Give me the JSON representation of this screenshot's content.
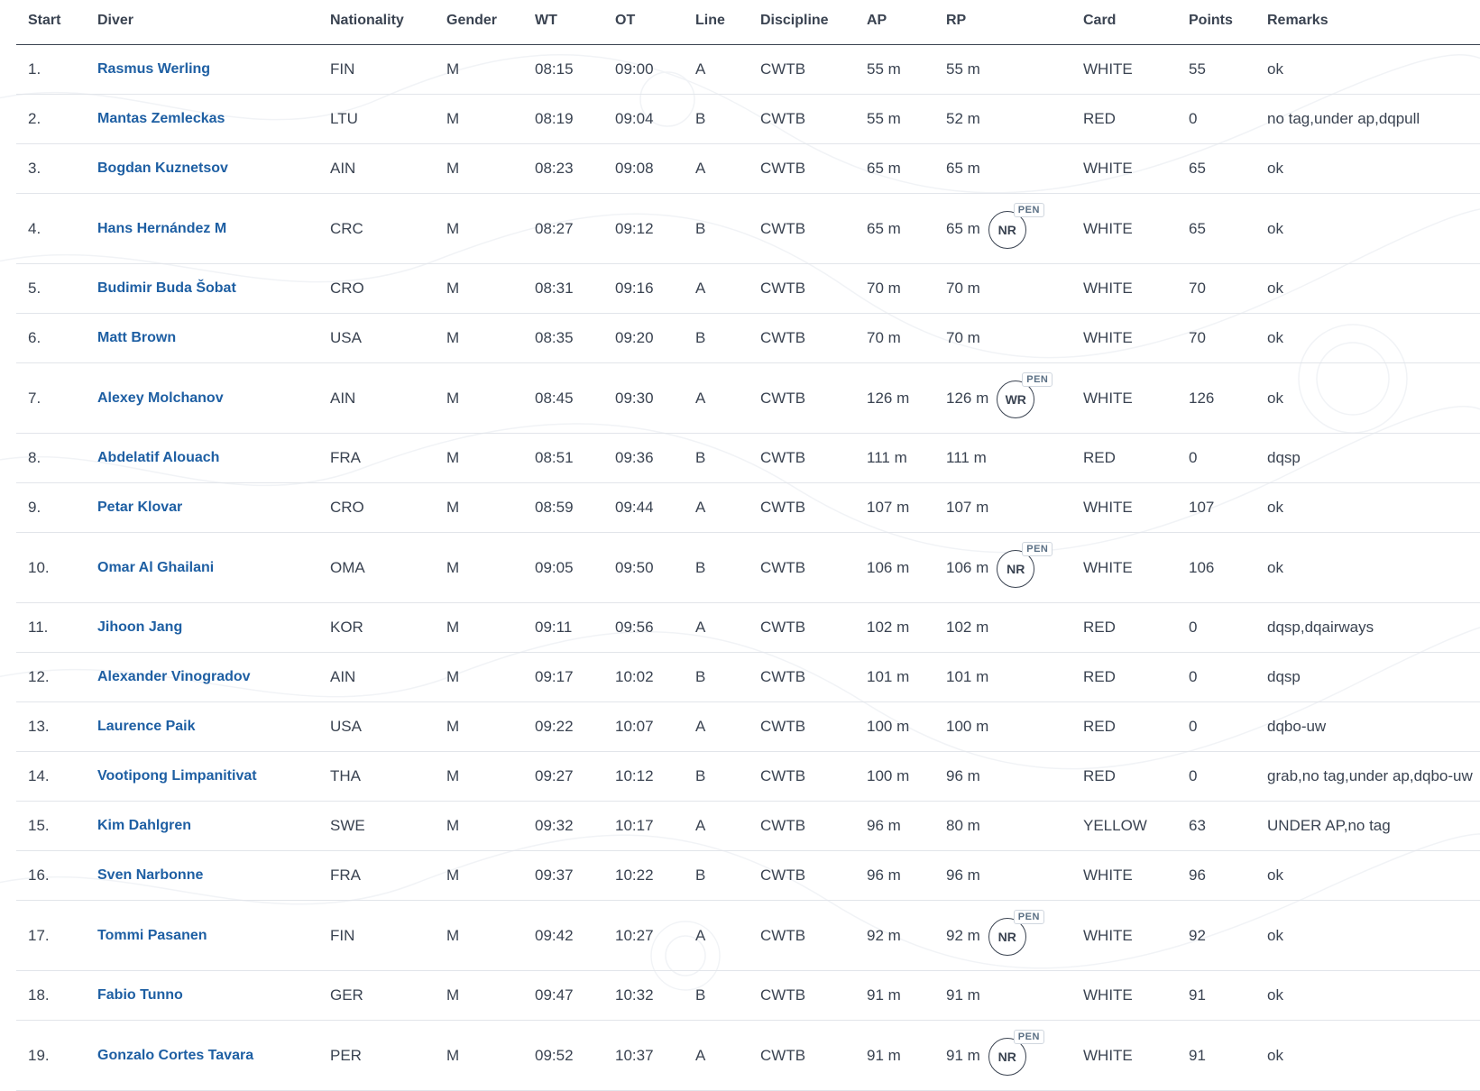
{
  "headers": {
    "start": "Start",
    "diver": "Diver",
    "nationality": "Nationality",
    "gender": "Gender",
    "wt": "WT",
    "ot": "OT",
    "line": "Line",
    "discipline": "Discipline",
    "ap": "AP",
    "rp": "RP",
    "card": "Card",
    "points": "Points",
    "remarks": "Remarks"
  },
  "colors": {
    "link": "#1e5fa3",
    "text": "#3a4351",
    "divider": "#e2e5ea"
  },
  "rows": [
    {
      "start": "1.",
      "diver": "Rasmus Werling",
      "nat": "FIN",
      "gender": "M",
      "wt": "08:15",
      "ot": "09:00",
      "line": "A",
      "disc": "CWTB",
      "ap": "55 m",
      "rp": "55 m",
      "badge": "",
      "pen": "",
      "card": "WHITE",
      "points": "55",
      "remarks": "ok"
    },
    {
      "start": "2.",
      "diver": "Mantas Zemleckas",
      "nat": "LTU",
      "gender": "M",
      "wt": "08:19",
      "ot": "09:04",
      "line": "B",
      "disc": "CWTB",
      "ap": "55 m",
      "rp": "52 m",
      "badge": "",
      "pen": "",
      "card": "RED",
      "points": "0",
      "remarks": "no tag,under ap,dqpull"
    },
    {
      "start": "3.",
      "diver": "Bogdan Kuznetsov",
      "nat": "AIN",
      "gender": "M",
      "wt": "08:23",
      "ot": "09:08",
      "line": "A",
      "disc": "CWTB",
      "ap": "65 m",
      "rp": "65 m",
      "badge": "",
      "pen": "",
      "card": "WHITE",
      "points": "65",
      "remarks": "ok"
    },
    {
      "start": "4.",
      "diver": "Hans Hernández M",
      "nat": "CRC",
      "gender": "M",
      "wt": "08:27",
      "ot": "09:12",
      "line": "B",
      "disc": "CWTB",
      "ap": "65 m",
      "rp": "65 m",
      "badge": "NR",
      "pen": "PEN",
      "card": "WHITE",
      "points": "65",
      "remarks": "ok"
    },
    {
      "start": "5.",
      "diver": "Budimir Buda Šobat",
      "nat": "CRO",
      "gender": "M",
      "wt": "08:31",
      "ot": "09:16",
      "line": "A",
      "disc": "CWTB",
      "ap": "70 m",
      "rp": "70 m",
      "badge": "",
      "pen": "",
      "card": "WHITE",
      "points": "70",
      "remarks": "ok"
    },
    {
      "start": "6.",
      "diver": "Matt Brown",
      "nat": "USA",
      "gender": "M",
      "wt": "08:35",
      "ot": "09:20",
      "line": "B",
      "disc": "CWTB",
      "ap": "70 m",
      "rp": "70 m",
      "badge": "",
      "pen": "",
      "card": "WHITE",
      "points": "70",
      "remarks": "ok"
    },
    {
      "start": "7.",
      "diver": "Alexey Molchanov",
      "nat": "AIN",
      "gender": "M",
      "wt": "08:45",
      "ot": "09:30",
      "line": "A",
      "disc": "CWTB",
      "ap": "126 m",
      "rp": "126 m",
      "badge": "WR",
      "pen": "PEN",
      "card": "WHITE",
      "points": "126",
      "remarks": "ok"
    },
    {
      "start": "8.",
      "diver": "Abdelatif Alouach",
      "nat": "FRA",
      "gender": "M",
      "wt": "08:51",
      "ot": "09:36",
      "line": "B",
      "disc": "CWTB",
      "ap": "111 m",
      "rp": "111 m",
      "badge": "",
      "pen": "",
      "card": "RED",
      "points": "0",
      "remarks": "dqsp"
    },
    {
      "start": "9.",
      "diver": "Petar Klovar",
      "nat": "CRO",
      "gender": "M",
      "wt": "08:59",
      "ot": "09:44",
      "line": "A",
      "disc": "CWTB",
      "ap": "107 m",
      "rp": "107 m",
      "badge": "",
      "pen": "",
      "card": "WHITE",
      "points": "107",
      "remarks": "ok"
    },
    {
      "start": "10.",
      "diver": "Omar Al Ghailani",
      "nat": "OMA",
      "gender": "M",
      "wt": "09:05",
      "ot": "09:50",
      "line": "B",
      "disc": "CWTB",
      "ap": "106 m",
      "rp": "106 m",
      "badge": "NR",
      "pen": "PEN",
      "card": "WHITE",
      "points": "106",
      "remarks": "ok"
    },
    {
      "start": "11.",
      "diver": "Jihoon Jang",
      "nat": "KOR",
      "gender": "M",
      "wt": "09:11",
      "ot": "09:56",
      "line": "A",
      "disc": "CWTB",
      "ap": "102 m",
      "rp": "102 m",
      "badge": "",
      "pen": "",
      "card": "RED",
      "points": "0",
      "remarks": "dqsp,dqairways"
    },
    {
      "start": "12.",
      "diver": "Alexander Vinogradov",
      "nat": "AIN",
      "gender": "M",
      "wt": "09:17",
      "ot": "10:02",
      "line": "B",
      "disc": "CWTB",
      "ap": "101 m",
      "rp": "101 m",
      "badge": "",
      "pen": "",
      "card": "RED",
      "points": "0",
      "remarks": "dqsp"
    },
    {
      "start": "13.",
      "diver": "Laurence Paik",
      "nat": "USA",
      "gender": "M",
      "wt": "09:22",
      "ot": "10:07",
      "line": "A",
      "disc": "CWTB",
      "ap": "100 m",
      "rp": "100 m",
      "badge": "",
      "pen": "",
      "card": "RED",
      "points": "0",
      "remarks": "dqbo-uw"
    },
    {
      "start": "14.",
      "diver": "Vootipong Limpanitivat",
      "nat": "THA",
      "gender": "M",
      "wt": "09:27",
      "ot": "10:12",
      "line": "B",
      "disc": "CWTB",
      "ap": "100 m",
      "rp": "96 m",
      "badge": "",
      "pen": "",
      "card": "RED",
      "points": "0",
      "remarks": "grab,no tag,under ap,dqbo-uw"
    },
    {
      "start": "15.",
      "diver": "Kim Dahlgren",
      "nat": "SWE",
      "gender": "M",
      "wt": "09:32",
      "ot": "10:17",
      "line": "A",
      "disc": "CWTB",
      "ap": "96 m",
      "rp": "80 m",
      "badge": "",
      "pen": "",
      "card": "YELLOW",
      "points": "63",
      "remarks": "UNDER AP,no tag"
    },
    {
      "start": "16.",
      "diver": "Sven Narbonne",
      "nat": "FRA",
      "gender": "M",
      "wt": "09:37",
      "ot": "10:22",
      "line": "B",
      "disc": "CWTB",
      "ap": "96 m",
      "rp": "96 m",
      "badge": "",
      "pen": "",
      "card": "WHITE",
      "points": "96",
      "remarks": "ok"
    },
    {
      "start": "17.",
      "diver": "Tommi Pasanen",
      "nat": "FIN",
      "gender": "M",
      "wt": "09:42",
      "ot": "10:27",
      "line": "A",
      "disc": "CWTB",
      "ap": "92 m",
      "rp": "92 m",
      "badge": "NR",
      "pen": "PEN",
      "card": "WHITE",
      "points": "92",
      "remarks": "ok"
    },
    {
      "start": "18.",
      "diver": "Fabio Tunno",
      "nat": "GER",
      "gender": "M",
      "wt": "09:47",
      "ot": "10:32",
      "line": "B",
      "disc": "CWTB",
      "ap": "91 m",
      "rp": "91 m",
      "badge": "",
      "pen": "",
      "card": "WHITE",
      "points": "91",
      "remarks": "ok"
    },
    {
      "start": "19.",
      "diver": "Gonzalo Cortes Tavara",
      "nat": "PER",
      "gender": "M",
      "wt": "09:52",
      "ot": "10:37",
      "line": "A",
      "disc": "CWTB",
      "ap": "91 m",
      "rp": "91 m",
      "badge": "NR",
      "pen": "PEN",
      "card": "WHITE",
      "points": "91",
      "remarks": "ok"
    }
  ]
}
